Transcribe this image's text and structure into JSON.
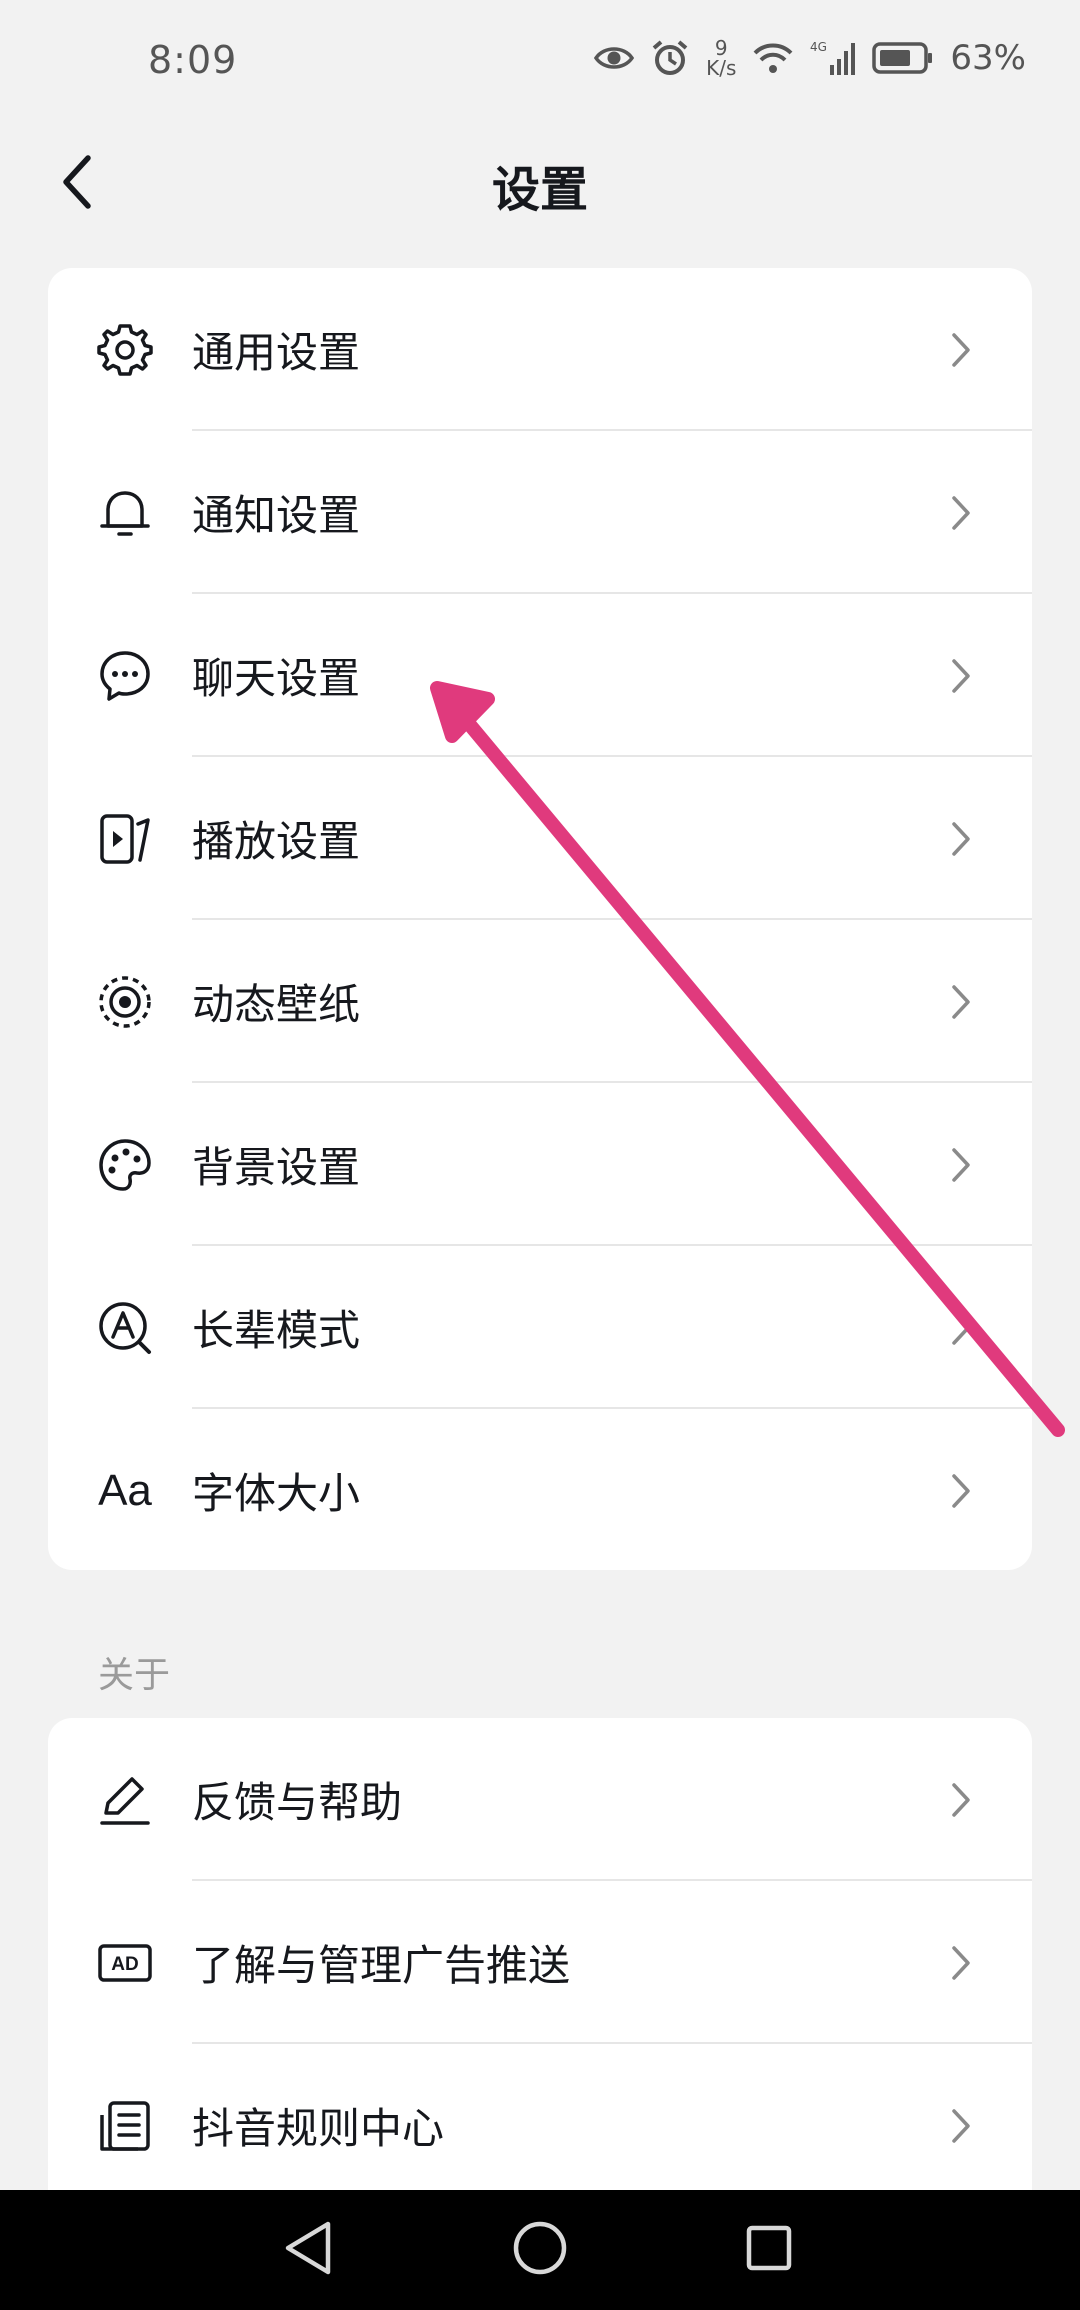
{
  "status_bar": {
    "time": "8:09",
    "net_speed_value": "9",
    "net_speed_unit": "K/s",
    "network_type": "4G",
    "battery": "63%",
    "icons": [
      "eye-icon",
      "alarm-icon",
      "wifi-icon",
      "signal-icon",
      "battery-icon"
    ]
  },
  "header": {
    "title": "设置",
    "back_icon": "chevron-left-icon"
  },
  "settings": {
    "items": [
      {
        "label": "通用设置",
        "icon": "gear-icon"
      },
      {
        "label": "通知设置",
        "icon": "bell-icon"
      },
      {
        "label": "聊天设置",
        "icon": "chat-bubble-icon"
      },
      {
        "label": "播放设置",
        "icon": "play-panel-icon"
      },
      {
        "label": "动态壁纸",
        "icon": "live-wallpaper-icon"
      },
      {
        "label": "背景设置",
        "icon": "palette-icon"
      },
      {
        "label": "长辈模式",
        "icon": "elder-mode-icon"
      },
      {
        "label": "字体大小",
        "icon": "font-size-icon",
        "icon_text": "Aa"
      }
    ]
  },
  "about": {
    "section_label": "关于",
    "items": [
      {
        "label": "反馈与帮助",
        "icon": "pen-icon"
      },
      {
        "label": "了解与管理广告推送",
        "icon": "ad-icon",
        "icon_text": "AD"
      },
      {
        "label": "抖音规则中心",
        "icon": "document-icon"
      }
    ]
  },
  "annotation": {
    "color": "#e03a7d"
  },
  "colors": {
    "background": "#f2f2f2",
    "card": "#ffffff",
    "text": "#16181d",
    "secondary_text": "#9a9a9a",
    "chevron": "#8a8a8a"
  }
}
